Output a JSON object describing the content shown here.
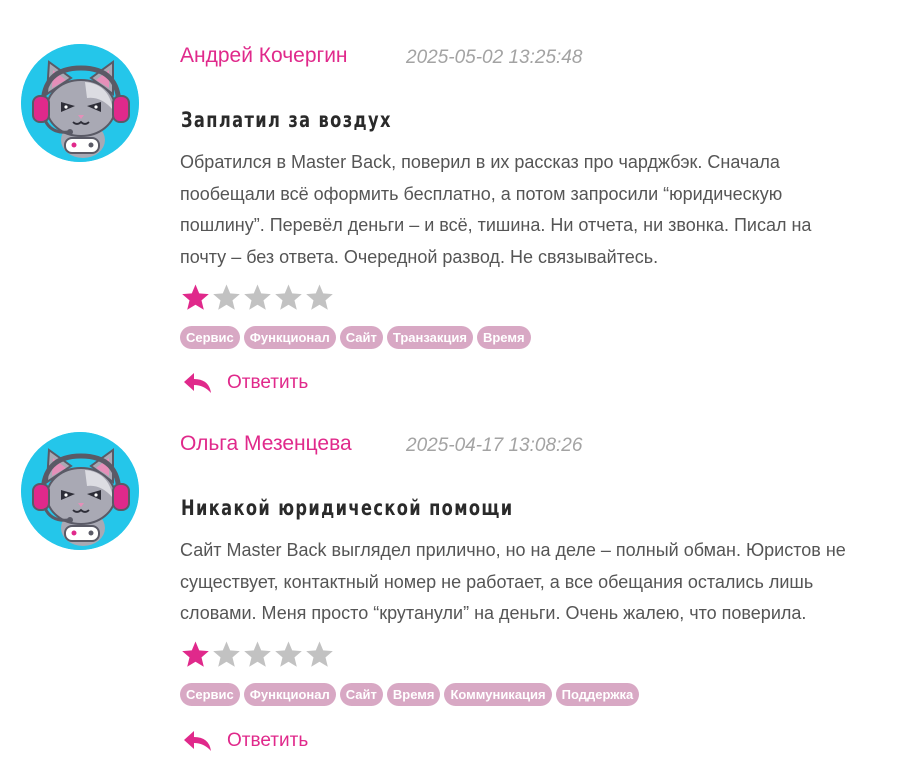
{
  "colors": {
    "author": "#e0298b",
    "star_filled": "#e0298b",
    "star_empty": "#c2c2c2",
    "tag_bg": "#d8a8c4",
    "avatar_bg": "#24c6ea"
  },
  "reviews": [
    {
      "avatar_icon": "gamer-cat-icon",
      "author": "Андрей Кочергин",
      "date": "2025-05-02 13:25:48",
      "title": "Заплатил за воздух",
      "body_lines": [
        "Обратился в Master Back, поверил в их рассказ про чарджбэк. Сначала",
        "пообещали всё оформить бесплатно, а потом запросили “юридическую",
        "пошлину”. Перевёл деньги – и всё, тишина. Ни отчета, ни звонка. Писал на",
        "почту – без ответа. Очередной развод. Не связывайтесь."
      ],
      "rating": 1,
      "rating_max": 5,
      "tags": [
        "Сервис",
        "Функционал",
        "Сайт",
        "Транзакция",
        "Время"
      ],
      "reply_label": "Ответить"
    },
    {
      "avatar_icon": "gamer-cat-icon",
      "author": "Ольга Мезенцева",
      "date": "2025-04-17 13:08:26",
      "title": "Никакой юридической помощи",
      "body_lines": [
        "Сайт Master Back выглядел прилично, но на деле – полный обман. Юристов не",
        "существует, контактный номер не работает, а все обещания остались лишь",
        "словами. Меня просто “крутанули” на деньги. Очень жалею, что поверила."
      ],
      "rating": 1,
      "rating_max": 5,
      "tags": [
        "Сервис",
        "Функционал",
        "Сайт",
        "Время",
        "Коммуникация",
        "Поддержка"
      ],
      "reply_label": "Ответить"
    }
  ]
}
